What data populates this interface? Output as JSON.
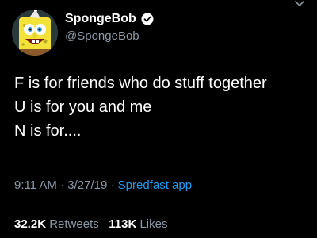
{
  "header": {
    "display_name": "SpongeBob",
    "handle": "@SpongeBob",
    "avatar_icon": "spongebob-avatar",
    "verified_icon": "verified-badge-icon",
    "menu_icon": "chevron-down-icon"
  },
  "tweet": {
    "lines": [
      "F is for friends who do stuff together",
      "U is for you and me",
      "N is for...."
    ]
  },
  "meta": {
    "time": "9:11 AM",
    "date": "3/27/19",
    "separator": "·",
    "source": "Spredfast app"
  },
  "stats": {
    "retweets_count": "32.2K",
    "retweets_label": "Retweets",
    "likes_count": "113K",
    "likes_label": "Likes"
  },
  "colors": {
    "background": "#000000",
    "text": "#ffffff",
    "secondary_text": "#8b98a5",
    "link": "#1d9bf0"
  }
}
